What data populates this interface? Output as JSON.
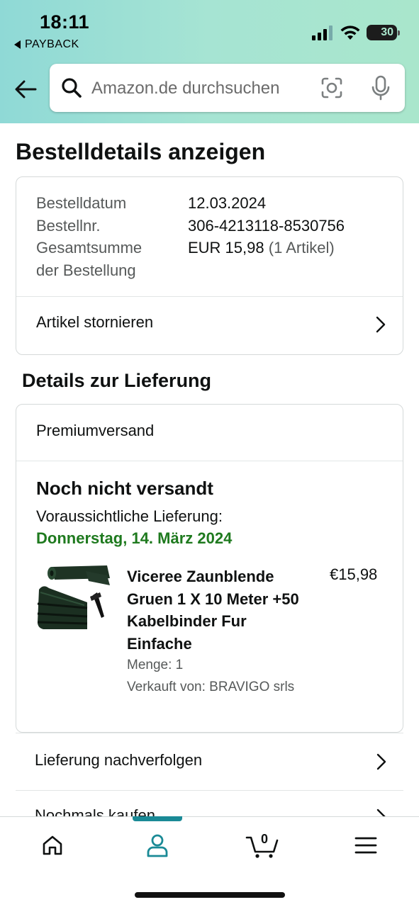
{
  "status_bar": {
    "time": "18:11",
    "back_app": "PAYBACK",
    "battery": "30"
  },
  "search": {
    "placeholder": "Amazon.de durchsuchen"
  },
  "page": {
    "title": "Bestelldetails anzeigen"
  },
  "order_summary": {
    "rows": [
      {
        "label": "Bestelldatum",
        "value": "12.03.2024"
      },
      {
        "label": "Bestellnr.",
        "value": "306-4213118-8530756"
      },
      {
        "label_line1": "Gesamtsumme",
        "label_line2": "der Bestellung",
        "value": "EUR 15,98",
        "value_extra": "(1 Artikel)"
      }
    ],
    "cancel_link": "Artikel stornieren"
  },
  "delivery": {
    "section_title": "Details zur Lieferung",
    "shipping_method": "Premiumversand",
    "status": "Noch nicht versandt",
    "expected_label": "Voraussichtliche Lieferung:",
    "expected_date": "Donnerstag, 14. März 2024",
    "expected_date_color": "#1f7a1f",
    "item": {
      "name": "Viceree Zaunblende Gruen 1 X 10 Meter +50 Kabelbinder Fur Einfache",
      "price": "€15,98",
      "quantity": "Menge: 1",
      "seller": "Verkauft von: BRAVIGO srls"
    }
  },
  "actions": {
    "track": "Lieferung nachverfolgen",
    "buy_again": "Nochmals kaufen"
  },
  "bottom_nav": {
    "items": [
      {
        "icon": "home-icon"
      },
      {
        "icon": "account-icon",
        "active": true
      },
      {
        "icon": "cart-icon",
        "count": "0"
      },
      {
        "icon": "menu-icon"
      }
    ],
    "accent_color": "#1a8a96"
  }
}
